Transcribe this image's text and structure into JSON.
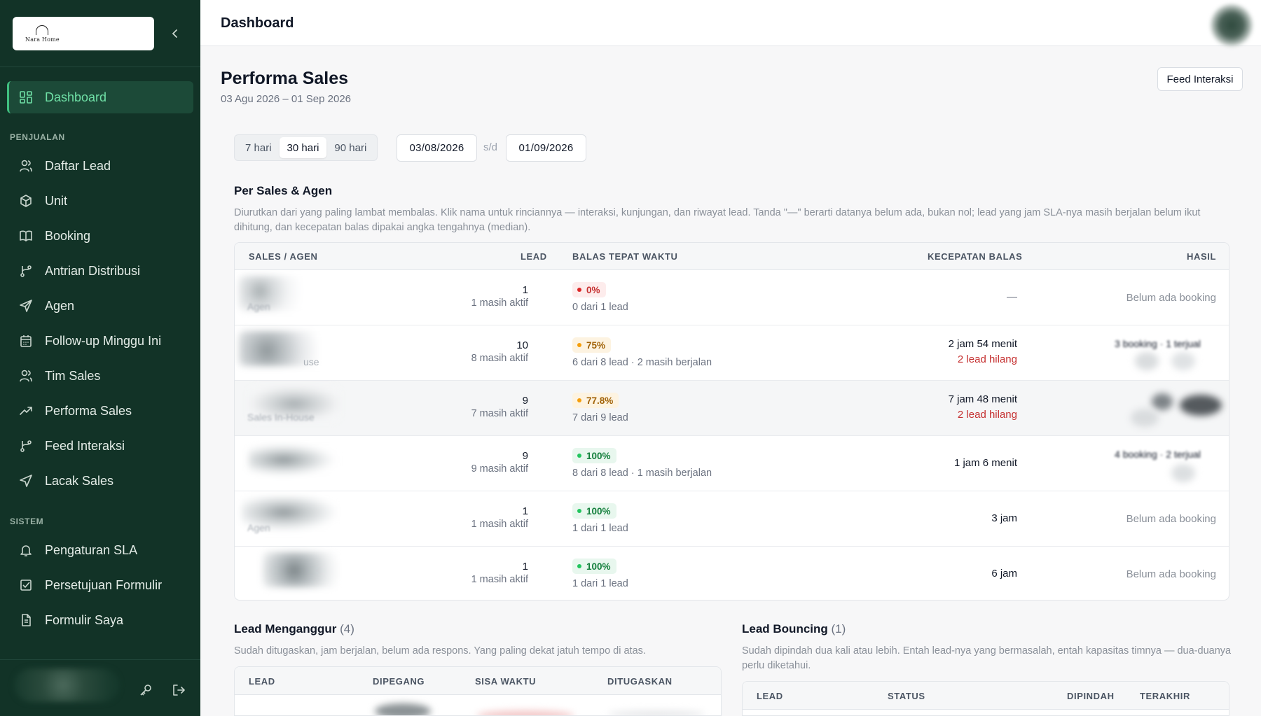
{
  "brand": {
    "name": "Nara Home"
  },
  "sidebar": {
    "items": [
      {
        "label": "Dashboard",
        "icon": "dashboard-icon",
        "active": true
      },
      {
        "label": "Daftar Lead",
        "icon": "users-icon"
      },
      {
        "label": "Unit",
        "icon": "box-icon"
      },
      {
        "label": "Booking",
        "icon": "book-icon"
      },
      {
        "label": "Antrian Distribusi",
        "icon": "git-branch-icon"
      },
      {
        "label": "Agen",
        "icon": "send-icon"
      },
      {
        "label": "Follow-up Minggu Ini",
        "icon": "calendar-icon"
      },
      {
        "label": "Tim Sales",
        "icon": "users-icon"
      },
      {
        "label": "Performa Sales",
        "icon": "trending-up-icon"
      },
      {
        "label": "Feed Interaksi",
        "icon": "git-branch-icon"
      },
      {
        "label": "Lacak Sales",
        "icon": "navigation-icon"
      },
      {
        "label": "Pengaturan SLA",
        "icon": "bell-icon"
      },
      {
        "label": "Persetujuan Formulir",
        "icon": "check-square-icon"
      },
      {
        "label": "Formulir Saya",
        "icon": "file-icon"
      }
    ],
    "sections": {
      "sales": "PENJUALAN",
      "system": "SISTEM"
    }
  },
  "header": {
    "title": "Dashboard"
  },
  "page": {
    "title": "Performa Sales",
    "subtitle": "03 Agu 2026 – 01 Sep 2026",
    "feed_button": "Feed Interaksi"
  },
  "filters": {
    "ranges": [
      "7 hari",
      "30 hari",
      "90 hari"
    ],
    "selected": "30 hari",
    "date_from": "03/08/2026",
    "separator": "s/d",
    "date_to": "01/09/2026"
  },
  "per_sales": {
    "title": "Per Sales & Agen",
    "description": "Diurutkan dari yang paling lambat membalas. Klik nama untuk rinciannya — interaksi, kunjungan, dan riwayat lead. Tanda \"—\" berarti datanya belum ada, bukan nol; lead yang jam SLA-nya masih berjalan belum ikut dihitung, dan kecepatan balas dipakai angka tengahnya (median).",
    "columns": [
      "SALES / AGEN",
      "LEAD",
      "BALAS TEPAT WAKTU",
      "KECEPATAN BALAS",
      "HASIL"
    ],
    "rows": [
      {
        "role": "Agen",
        "lead": "1",
        "lead_sub": "1 masih aktif",
        "ontime": "0%",
        "ontime_tone": "red",
        "ontime_sub": "0 dari 1 lead",
        "speed": "—",
        "lost": "",
        "hasil": "Belum ada booking"
      },
      {
        "role": "use",
        "lead": "10",
        "lead_sub": "8 masih aktif",
        "ontime": "75%",
        "ontime_tone": "amber",
        "ontime_sub": "6 dari 8 lead · 2 masih berjalan",
        "speed": "2 jam 54 menit",
        "lost": "2 lead hilang",
        "hasil": "3 booking · 1 terjual"
      },
      {
        "role": "Sales In-House",
        "lead": "9",
        "lead_sub": "7 masih aktif",
        "ontime": "77.8%",
        "ontime_tone": "amber",
        "ontime_sub": "7 dari 9 lead",
        "speed": "7 jam 48 menit",
        "lost": "2 lead hilang",
        "hasil": ""
      },
      {
        "role": "",
        "lead": "9",
        "lead_sub": "9 masih aktif",
        "ontime": "100%",
        "ontime_tone": "green",
        "ontime_sub": "8 dari 8 lead · 1 masih berjalan",
        "speed": "1 jam 6 menit",
        "lost": "",
        "hasil": "4 booking · 2 terjual"
      },
      {
        "role": "Agen",
        "lead": "1",
        "lead_sub": "1 masih aktif",
        "ontime": "100%",
        "ontime_tone": "green",
        "ontime_sub": "1 dari 1 lead",
        "speed": "3 jam",
        "lost": "",
        "hasil": "Belum ada booking"
      },
      {
        "role": "",
        "lead": "1",
        "lead_sub": "1 masih aktif",
        "ontime": "100%",
        "ontime_tone": "green",
        "ontime_sub": "1 dari 1 lead",
        "speed": "6 jam",
        "lost": "",
        "hasil": "Belum ada booking"
      }
    ]
  },
  "idle_leads": {
    "title": "Lead Menganggur",
    "count": "(4)",
    "description": "Sudah ditugaskan, jam berjalan, belum ada respons. Yang paling dekat jatuh tempo di atas.",
    "columns": [
      "LEAD",
      "DIPEGANG",
      "SISA WAKTU",
      "DITUGASKAN"
    ]
  },
  "bouncing_leads": {
    "title": "Lead Bouncing",
    "count": "(1)",
    "description": "Sudah dipindah dua kali atau lebih. Entah lead-nya yang bermasalah, entah kapasitas timnya — dua-duanya perlu diketahui.",
    "columns": [
      "LEAD",
      "STATUS",
      "DIPINDAH",
      "TERAKHIR"
    ]
  },
  "colors": {
    "sidebar_bg": "#123327",
    "accent": "#3fbf7f",
    "danger": "#c53030"
  }
}
